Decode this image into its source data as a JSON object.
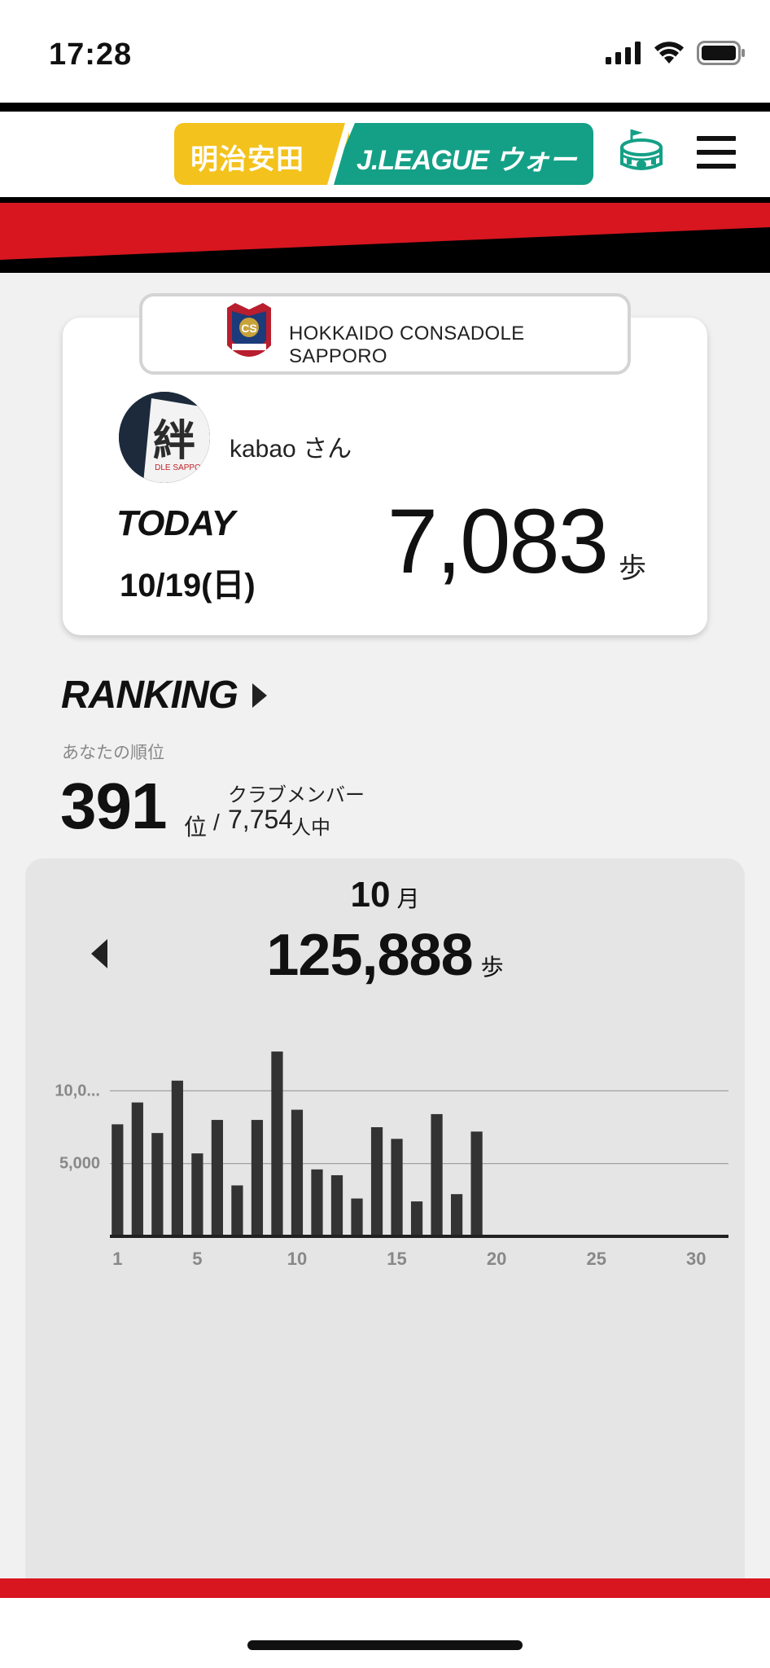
{
  "status_bar": {
    "time": "17:28"
  },
  "header": {
    "logo_left": "明治安田",
    "logo_right": "J.LEAGUE ウォーキング",
    "stadium_icon": "stadium-icon",
    "menu_icon": "hamburger-menu-icon"
  },
  "profile": {
    "club_name": "HOKKAIDO CONSADOLE SAPPORO",
    "username": "kabao さん",
    "today_label": "TODAY",
    "today_date": "10/19(日)",
    "today_steps": "7,083",
    "steps_unit": "歩"
  },
  "ranking": {
    "title": "RANKING",
    "caption": "あなたの順位",
    "rank": "391",
    "rank_unit": "位",
    "separator": "/",
    "member_caption": "クラブメンバー",
    "member_count": "7,754",
    "member_unit": "人中"
  },
  "month": {
    "month_number": "10",
    "month_unit": "月",
    "total_steps": "125,888",
    "steps_unit": "歩"
  },
  "chart_data": {
    "type": "bar",
    "x": [
      1,
      2,
      3,
      4,
      5,
      6,
      7,
      8,
      9,
      10,
      11,
      12,
      13,
      14,
      15,
      16,
      17,
      18,
      19,
      20,
      21,
      22,
      23,
      24,
      25,
      26,
      27,
      28,
      29,
      30,
      31
    ],
    "values": [
      7700,
      9200,
      7100,
      10700,
      5700,
      8000,
      3500,
      8000,
      12700,
      8700,
      4600,
      4200,
      2600,
      7500,
      6700,
      2400,
      8400,
      2900,
      7200,
      0,
      0,
      0,
      0,
      0,
      0,
      0,
      0,
      0,
      0,
      0,
      0
    ],
    "xticks": [
      "1",
      "5",
      "10",
      "15",
      "20",
      "25",
      "30"
    ],
    "xtick_values": [
      1,
      5,
      10,
      15,
      20,
      25,
      30
    ],
    "yticks": [
      "5,000",
      "10,0..."
    ],
    "ytick_values": [
      5000,
      10000
    ],
    "ylim": [
      0,
      15000
    ],
    "grid": true,
    "colors": {
      "bar": "#333333",
      "grid": "#999999",
      "axis": "#222222"
    }
  }
}
